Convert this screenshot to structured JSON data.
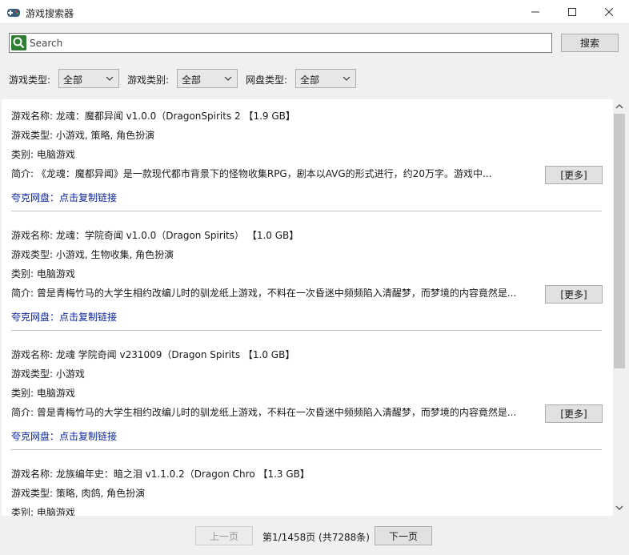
{
  "window": {
    "title": "游戏搜索器",
    "min_icon": "minimize-icon",
    "max_icon": "maximize-icon",
    "close_icon": "close-icon"
  },
  "search": {
    "placeholder": "Search",
    "button_label": "搜索"
  },
  "filters": [
    {
      "label": "游戏类型:",
      "value": "全部"
    },
    {
      "label": "游戏类别:",
      "value": "全部"
    },
    {
      "label": "网盘类型:",
      "value": "全部"
    }
  ],
  "results": [
    {
      "name": "游戏名称:  龙魂：魔都异闻 v1.0.0（DragonSpirits 2 【1.9 GB】",
      "types": "游戏类型:    小游戏,    策略,    角色扮演",
      "category": "类别: 电脑游戏",
      "intro": "简介:    《龙魂：魔都异闻》是一款现代都市背景下的怪物收集RPG，剧本以AVG的形式进行，约20万字。游戏中...",
      "more_label": "[更多]",
      "link": "夸克网盘：点击复制链接"
    },
    {
      "name": "游戏名称:  龙魂：学院奇闻 v1.0.0（Dragon Spirits）  【1.0 GB】",
      "types": "游戏类型:    小游戏,    生物收集,    角色扮演",
      "category": "类别: 电脑游戏",
      "intro": "简介:    曾是青梅竹马的大学生相约改编儿时的驯龙纸上游戏，不料在一次昏迷中频频陷入清醒梦，而梦境的内容竟然是...",
      "more_label": "[更多]",
      "link": "夸克网盘：点击复制链接"
    },
    {
      "name": "游戏名称:  龙魂 学院奇闻 v231009（Dragon Spirits 【1.0 GB】",
      "types": "游戏类型:    小游戏",
      "category": "类别: 电脑游戏",
      "intro": "简介:    曾是青梅竹马的大学生相约改编儿时的驯龙纸上游戏，不料在一次昏迷中频频陷入清醒梦，而梦境的内容竟然是...",
      "more_label": "[更多]",
      "link": "夸克网盘：点击复制链接"
    },
    {
      "name": "游戏名称:  龙族编年史：暗之泪 v1.1.0.2（Dragon Chro 【1.3 GB】",
      "types": "游戏类型:    策略,    肉鸽,    角色扮演",
      "category": "类别: 电脑游戏"
    }
  ],
  "pager": {
    "prev_label": "上一页",
    "status": "第1/1458页 (共7288条)",
    "next_label": "下一页"
  }
}
